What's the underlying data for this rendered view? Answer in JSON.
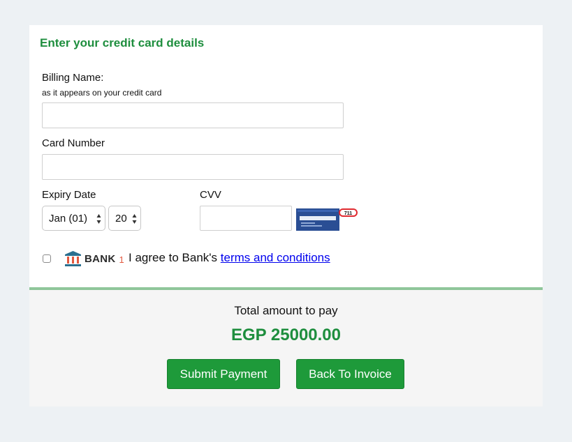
{
  "form": {
    "heading": "Enter your credit card details",
    "billing_name_label": "Billing Name:",
    "billing_name_hint": "as it appears on your credit card",
    "billing_name_value": "",
    "card_number_label": "Card Number",
    "card_number_value": "",
    "expiry_label": "Expiry Date",
    "expiry_month": "Jan (01)",
    "expiry_year": "20",
    "cvv_label": "CVV",
    "cvv_value": "",
    "cvv_badge": "711",
    "cvv_image_icon": "credit-card-back-icon"
  },
  "agreement": {
    "bank_logo_text": "BANK",
    "bank_logo_number": "1",
    "text": "I agree to Bank's ",
    "link": "terms and conditions",
    "checked": false
  },
  "summary": {
    "total_label": "Total amount to pay",
    "total_amount": "EGP 25000.00"
  },
  "buttons": {
    "submit_label": "Submit Payment",
    "back_label": "Back To Invoice"
  },
  "colors": {
    "accent": "#1e8e3e",
    "button": "#1e9a3a",
    "divider": "#8fc69a",
    "link": "#0000ee"
  }
}
